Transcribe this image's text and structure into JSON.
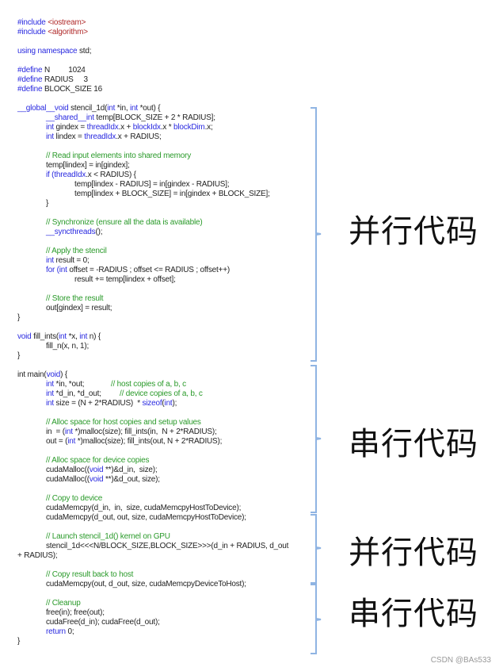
{
  "code": {
    "lines": [
      [
        {
          "t": "#include ",
          "c": "kw"
        },
        {
          "t": "<iostream>",
          "c": "str"
        }
      ],
      [
        {
          "t": "#include ",
          "c": "kw"
        },
        {
          "t": "<algorithm>",
          "c": "str"
        }
      ],
      [],
      [
        {
          "t": "using namespace ",
          "c": "kw"
        },
        {
          "t": "std;",
          "c": ""
        }
      ],
      [],
      [
        {
          "t": "#define ",
          "c": "kw"
        },
        {
          "t": "N         1024",
          "c": ""
        }
      ],
      [
        {
          "t": "#define ",
          "c": "kw"
        },
        {
          "t": "RADIUS     3",
          "c": ""
        }
      ],
      [
        {
          "t": "#define ",
          "c": "kw"
        },
        {
          "t": "BLOCK_SIZE 16",
          "c": ""
        }
      ],
      [],
      [
        {
          "t": "__global__void ",
          "c": "kw"
        },
        {
          "t": "stencil_1d(",
          "c": ""
        },
        {
          "t": "int ",
          "c": "kw"
        },
        {
          "t": "*in, ",
          "c": ""
        },
        {
          "t": "int ",
          "c": "kw"
        },
        {
          "t": "*out) {",
          "c": ""
        }
      ],
      [
        {
          "t": "\t__shared__int ",
          "c": "kw"
        },
        {
          "t": "temp[BLOCK_SIZE + 2 * RADIUS];",
          "c": ""
        }
      ],
      [
        {
          "t": "\tint ",
          "c": "kw"
        },
        {
          "t": "gindex = ",
          "c": ""
        },
        {
          "t": "threadIdx",
          "c": "kw"
        },
        {
          "t": ".x + ",
          "c": ""
        },
        {
          "t": "blockIdx",
          "c": "kw"
        },
        {
          "t": ".x * ",
          "c": ""
        },
        {
          "t": "blockDim",
          "c": "kw"
        },
        {
          "t": ".x;",
          "c": ""
        }
      ],
      [
        {
          "t": "\tint ",
          "c": "kw"
        },
        {
          "t": "lindex = ",
          "c": ""
        },
        {
          "t": "threadIdx",
          "c": "kw"
        },
        {
          "t": ".x + RADIUS;",
          "c": ""
        }
      ],
      [],
      [
        {
          "t": "\t// Read input elements into shared memory",
          "c": "cm"
        }
      ],
      [
        {
          "t": "\ttemp[lindex] = in[gindex];",
          "c": ""
        }
      ],
      [
        {
          "t": "\tif (",
          "c": "kw"
        },
        {
          "t": "threadIdx",
          "c": "kw"
        },
        {
          "t": ".x < RADIUS) {",
          "c": ""
        }
      ],
      [
        {
          "t": "\t\ttemp[lindex - RADIUS] = in[gindex - RADIUS];",
          "c": ""
        }
      ],
      [
        {
          "t": "\t\ttemp[lindex + BLOCK_SIZE] = in[gindex + BLOCK_SIZE];",
          "c": ""
        }
      ],
      [
        {
          "t": "\t}",
          "c": ""
        }
      ],
      [],
      [
        {
          "t": "\t// Synchronize (ensure all the data is available)",
          "c": "cm"
        }
      ],
      [
        {
          "t": "\t__syncthreads",
          "c": "kw"
        },
        {
          "t": "();",
          "c": ""
        }
      ],
      [],
      [
        {
          "t": "\t// Apply the stencil",
          "c": "cm"
        }
      ],
      [
        {
          "t": "\tint ",
          "c": "kw"
        },
        {
          "t": "result = 0;",
          "c": ""
        }
      ],
      [
        {
          "t": "\tfor (int ",
          "c": "kw"
        },
        {
          "t": "offset = -RADIUS ; offset <= RADIUS ; offset++)",
          "c": ""
        }
      ],
      [
        {
          "t": "\t\tresult += temp[lindex + offset];",
          "c": ""
        }
      ],
      [],
      [
        {
          "t": "\t// Store the result",
          "c": "cm"
        }
      ],
      [
        {
          "t": "\tout[gindex] = result;",
          "c": ""
        }
      ],
      [
        {
          "t": "}",
          "c": ""
        }
      ],
      [],
      [
        {
          "t": "void ",
          "c": "kw"
        },
        {
          "t": "fill_ints(",
          "c": ""
        },
        {
          "t": "int ",
          "c": "kw"
        },
        {
          "t": "*x, ",
          "c": ""
        },
        {
          "t": "int ",
          "c": "kw"
        },
        {
          "t": "n) {",
          "c": ""
        }
      ],
      [
        {
          "t": "\tfill_n(x, n, 1);",
          "c": ""
        }
      ],
      [
        {
          "t": "}",
          "c": ""
        }
      ],
      [],
      [
        {
          "t": "int ",
          "c": ""
        },
        {
          "t": "main(",
          "c": ""
        },
        {
          "t": "void",
          "c": "kw"
        },
        {
          "t": ") {",
          "c": ""
        }
      ],
      [
        {
          "t": "\tint ",
          "c": "kw"
        },
        {
          "t": "*in, *out;             ",
          "c": ""
        },
        {
          "t": "// host copies of a, b, c",
          "c": "cm"
        }
      ],
      [
        {
          "t": "\tint ",
          "c": "kw"
        },
        {
          "t": "*d_in, *d_out;         ",
          "c": ""
        },
        {
          "t": "// device copies of a, b, c",
          "c": "cm"
        }
      ],
      [
        {
          "t": "\tint ",
          "c": "kw"
        },
        {
          "t": "size = (N + 2*RADIUS)  * ",
          "c": ""
        },
        {
          "t": "sizeof",
          "c": "kw"
        },
        {
          "t": "(",
          "c": ""
        },
        {
          "t": "int",
          "c": "kw"
        },
        {
          "t": ");",
          "c": ""
        }
      ],
      [],
      [
        {
          "t": "\t// Alloc space for host copies and setup values",
          "c": "cm"
        }
      ],
      [
        {
          "t": "\tin  = (",
          "c": ""
        },
        {
          "t": "int ",
          "c": "kw"
        },
        {
          "t": "*)malloc(size); fill_ints(in,  N + 2*RADIUS);",
          "c": ""
        }
      ],
      [
        {
          "t": "\tout = (",
          "c": ""
        },
        {
          "t": "int ",
          "c": "kw"
        },
        {
          "t": "*)malloc(size); fill_ints(out, N + 2*RADIUS);",
          "c": ""
        }
      ],
      [],
      [
        {
          "t": "\t// Alloc space for device copies",
          "c": "cm"
        }
      ],
      [
        {
          "t": "\tcudaMalloc((",
          "c": ""
        },
        {
          "t": "void ",
          "c": "kw"
        },
        {
          "t": "**)&d_in,  size);",
          "c": ""
        }
      ],
      [
        {
          "t": "\tcudaMalloc((",
          "c": ""
        },
        {
          "t": "void ",
          "c": "kw"
        },
        {
          "t": "**)&d_out, size);",
          "c": ""
        }
      ],
      [],
      [
        {
          "t": "\t// Copy to device",
          "c": "cm"
        }
      ],
      [
        {
          "t": "\tcudaMemcpy(d_in,  in,  size, cudaMemcpyHostToDevice);",
          "c": ""
        }
      ],
      [
        {
          "t": "\tcudaMemcpy(d_out, out, size, cudaMemcpyHostToDevice);",
          "c": ""
        }
      ],
      [],
      [
        {
          "t": "\t// Launch stencil_1d() kernel on GPU",
          "c": "cm"
        }
      ],
      [
        {
          "t": "\tstencil_1d<<<N/BLOCK_SIZE,BLOCK_SIZE>>>(d_in + RADIUS, d_out",
          "c": ""
        }
      ],
      [
        {
          "t": "+ RADIUS);",
          "c": ""
        }
      ],
      [],
      [
        {
          "t": "\t// Copy result back to host",
          "c": "cm"
        }
      ],
      [
        {
          "t": "\tcudaMemcpy(out, d_out, size, cudaMemcpyDeviceToHost);",
          "c": ""
        }
      ],
      [],
      [
        {
          "t": "\t// Cleanup",
          "c": "cm"
        }
      ],
      [
        {
          "t": "\tfree(in); free(out);",
          "c": ""
        }
      ],
      [
        {
          "t": "\tcudaFree(d_in); cudaFree(d_out);",
          "c": ""
        }
      ],
      [
        {
          "t": "\treturn ",
          "c": "kw"
        },
        {
          "t": "0;",
          "c": ""
        }
      ],
      [
        {
          "t": "}",
          "c": ""
        }
      ]
    ]
  },
  "annotations": [
    {
      "label": "并行代码",
      "kind": "parallel",
      "from_line": 9,
      "to_line": 35
    },
    {
      "label": "串行代码",
      "kind": "serial",
      "from_line": 37,
      "to_line": 52
    },
    {
      "label": "并行代码",
      "kind": "parallel",
      "from_line": 54,
      "to_line": 56
    },
    {
      "label": "串行代码",
      "kind": "serial",
      "from_line": 58,
      "to_line": 65
    }
  ],
  "colors": {
    "keyword": "#2a2ae0",
    "string": "#b02a2a",
    "comment": "#2a9a2a",
    "bracket": "#8fb4e3",
    "text": "#222222"
  },
  "watermark": "CSDN @BAs533"
}
